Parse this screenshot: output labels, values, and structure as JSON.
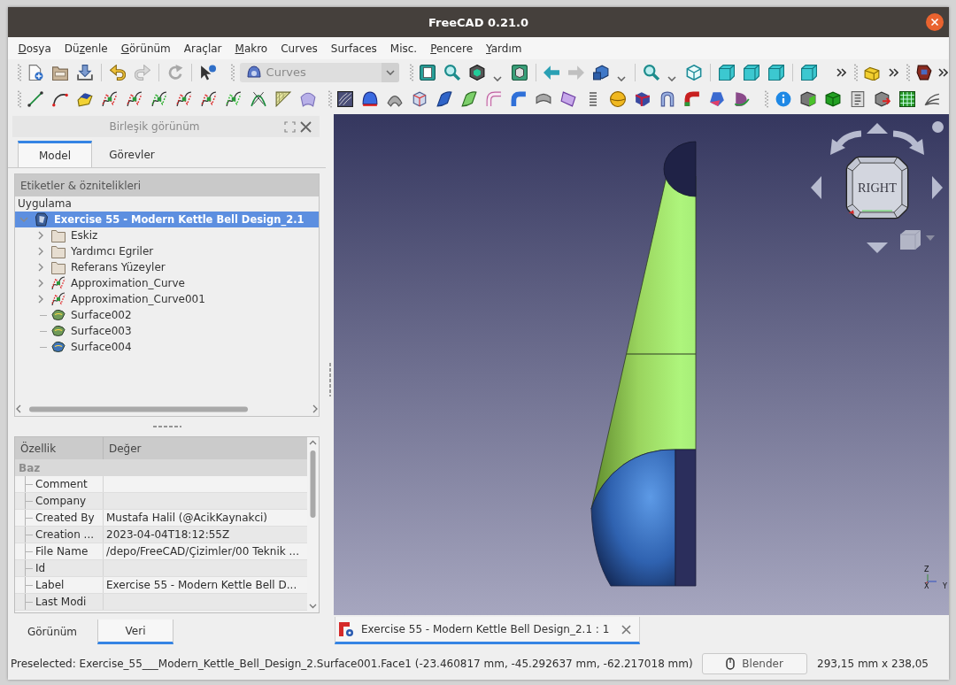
{
  "window": {
    "title": "FreeCAD 0.21.0"
  },
  "menu": [
    {
      "key": "D",
      "tail": "osya"
    },
    {
      "head": "Dü",
      "key": "z",
      "tail": "enle"
    },
    {
      "key": "G",
      "tail": "örünüm"
    },
    {
      "label": "Araçlar"
    },
    {
      "key": "M",
      "tail": "akro"
    },
    {
      "label": "Curves"
    },
    {
      "label": "Surfaces"
    },
    {
      "label": "Misc."
    },
    {
      "key": "P",
      "tail": "encere"
    },
    {
      "key": "Y",
      "tail": "ardım"
    }
  ],
  "toolbar": {
    "buttons": [
      {
        "disabled": false
      },
      {
        "disabled": false
      },
      {
        "disabled": false
      },
      {
        "disabled": false
      },
      {
        "disabled": true
      },
      {
        "disabled": true
      },
      {
        "disabled": false
      },
      {
        "disabled": false
      },
      {
        "disabled": false
      },
      {
        "disabled": false
      },
      {
        "disabled": false
      },
      {
        "disabled": false
      },
      {
        "disabled": true
      },
      {
        "disabled": false
      },
      {
        "disabled": false
      },
      {
        "disabled": false
      },
      {
        "disabled": false
      },
      {
        "disabled": false
      },
      {
        "disabled": false
      },
      {
        "disabled": false
      },
      {
        "disabled": false
      },
      {
        "disabled": false
      }
    ],
    "workbench": "Curves"
  },
  "combined_view": {
    "title": "Birleşik görünüm",
    "tabs": [
      {
        "label": "Model",
        "selected": true
      },
      {
        "label": "Görevler",
        "selected": false
      }
    ],
    "tree": {
      "header": "Etiketler & öznitelikleri",
      "root": "Uygulama",
      "items": [
        {
          "label": "Exercise 55 - Modern Kettle Bell Design_2.1",
          "kind": "document",
          "selected": true,
          "expanded": true,
          "children": [
            {
              "label": "Eskiz",
              "kind": "folder",
              "selected": false,
              "expanded": false
            },
            {
              "label": "Yardımcı Egriler",
              "kind": "folder",
              "selected": false,
              "expanded": false
            },
            {
              "label": "Referans Yüzeyler",
              "kind": "folder",
              "selected": false,
              "expanded": false
            },
            {
              "label": "Approximation_Curve",
              "kind": "curve",
              "selected": false,
              "expanded": false
            },
            {
              "label": "Approximation_Curve001",
              "kind": "curve",
              "selected": false,
              "expanded": false
            },
            {
              "label": "Surface002",
              "kind": "surface",
              "color": "#6f9a58",
              "selected": false
            },
            {
              "label": "Surface003",
              "kind": "surface",
              "color": "#6f9a58",
              "selected": false
            },
            {
              "label": "Surface004",
              "kind": "surface",
              "color": "#3f74b8",
              "selected": false
            }
          ]
        }
      ]
    }
  },
  "properties": {
    "columns": [
      "Özellik",
      "Değer"
    ],
    "group": "Baz",
    "rows": [
      {
        "name": "Comment"
      },
      {
        "name": "Company"
      },
      {
        "name": "Created By",
        "value": "Mustafa Halil (@AcikKaynakci)"
      },
      {
        "name": "Creation ...",
        "value": "2023-04-04T18:12:55Z"
      },
      {
        "name": "File Name",
        "value": "/depo/FreeCAD/Çizimler/00 Teknik ..."
      },
      {
        "name": "Id"
      },
      {
        "name": "Label",
        "value": "Exercise 55 - Modern Kettle Bell D..."
      },
      {
        "name": "Last Modi"
      }
    ],
    "tabs": [
      {
        "label": "Görünüm",
        "selected": false
      },
      {
        "label": "Veri",
        "selected": true
      }
    ]
  },
  "view_3d": {
    "nav_cube": {
      "face": "RIGHT"
    },
    "axes": [
      "Z",
      "X",
      "Y"
    ]
  },
  "document_tabs": [
    {
      "label": "Exercise 55 - Modern Kettle Bell Design_2.1 : 1",
      "selected": true
    }
  ],
  "status_bar": {
    "message": "Preselected: Exercise_55___Modern_Kettle_Bell_Design_2.Surface001.Face1 (-23.460817 mm, -45.292637 mm, -62.217018 mm)",
    "navigation": "Blender",
    "dimensions": "293,15 mm x 238,05"
  }
}
